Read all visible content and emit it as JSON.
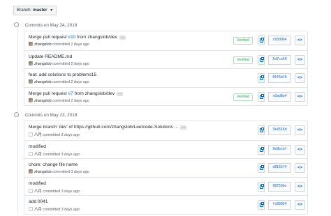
{
  "branch": {
    "label": "Branch:",
    "value": "master"
  },
  "groups": [
    {
      "heading": "Commits on May 24, 2018",
      "commits": [
        {
          "title_pre": "Merge pull request ",
          "pr": "#10",
          "title_post": " from zhangslob/dev",
          "has_ellipsis": true,
          "author": "zhangslob",
          "when": "committed 2 days ago",
          "verified": "Verified",
          "sha": "c93d9b4"
        },
        {
          "title_pre": "Update README.md",
          "pr": "",
          "title_post": "",
          "has_ellipsis": false,
          "author": "zhangslob",
          "when": "committed 2 days ago",
          "verified": "Verified",
          "sha": "5d7ce50"
        },
        {
          "title_pre": "feat: add solutions to problems15",
          "pr": "",
          "title_post": "",
          "has_ellipsis": false,
          "author": "zhangslob",
          "when": "committed 2 days ago",
          "verified": "",
          "sha": "66f6bf6"
        },
        {
          "title_pre": "Merge pull request ",
          "pr": "#7",
          "title_post": " from zhangslob/dev",
          "has_ellipsis": true,
          "author": "zhangslob",
          "when": "committed 2 days ago",
          "verified": "Verified",
          "sha": "c0ad8e4"
        }
      ]
    },
    {
      "heading": "Commits on May 23, 2018",
      "commits": [
        {
          "title_pre": "Merge branch 'dev' of https://github.com/zhangslob/Leetcode-Solutions ...",
          "pr": "",
          "title_post": "",
          "has_ellipsis": true,
          "author": "八月",
          "when": "committed 3 days ago",
          "verified": "",
          "sha": "3e4316d"
        },
        {
          "title_pre": "modified",
          "pr": "",
          "title_post": "",
          "has_ellipsis": false,
          "author": "八月",
          "when": "committed 3 days ago",
          "verified": "",
          "sha": "9e9bcbf"
        },
        {
          "title_pre": "chore: change file name",
          "pr": "",
          "title_post": "",
          "has_ellipsis": false,
          "author": "zhangslob",
          "when": "committed 3 days ago",
          "verified": "",
          "sha": "d8165f4"
        },
        {
          "title_pre": "modified",
          "pr": "",
          "title_post": "",
          "has_ellipsis": false,
          "author": "八月",
          "when": "committed 3 days ago",
          "verified": "",
          "sha": "98759bc"
        },
        {
          "title_pre": "add 0041",
          "pr": "",
          "title_post": "",
          "has_ellipsis": false,
          "author": "八月",
          "when": "committed 3 days ago",
          "verified": "",
          "sha": "fc89054"
        }
      ]
    }
  ],
  "icons": {
    "commit": "git-commit-icon",
    "copy": "clippy-icon",
    "browse": "code-icon",
    "branch_caret": "caret-down-icon"
  },
  "ellipsis_label": "…",
  "browse_label": "<>",
  "colors": {
    "link": "#0366d6",
    "verified": "#28a745",
    "border": "#e1e4e8"
  }
}
